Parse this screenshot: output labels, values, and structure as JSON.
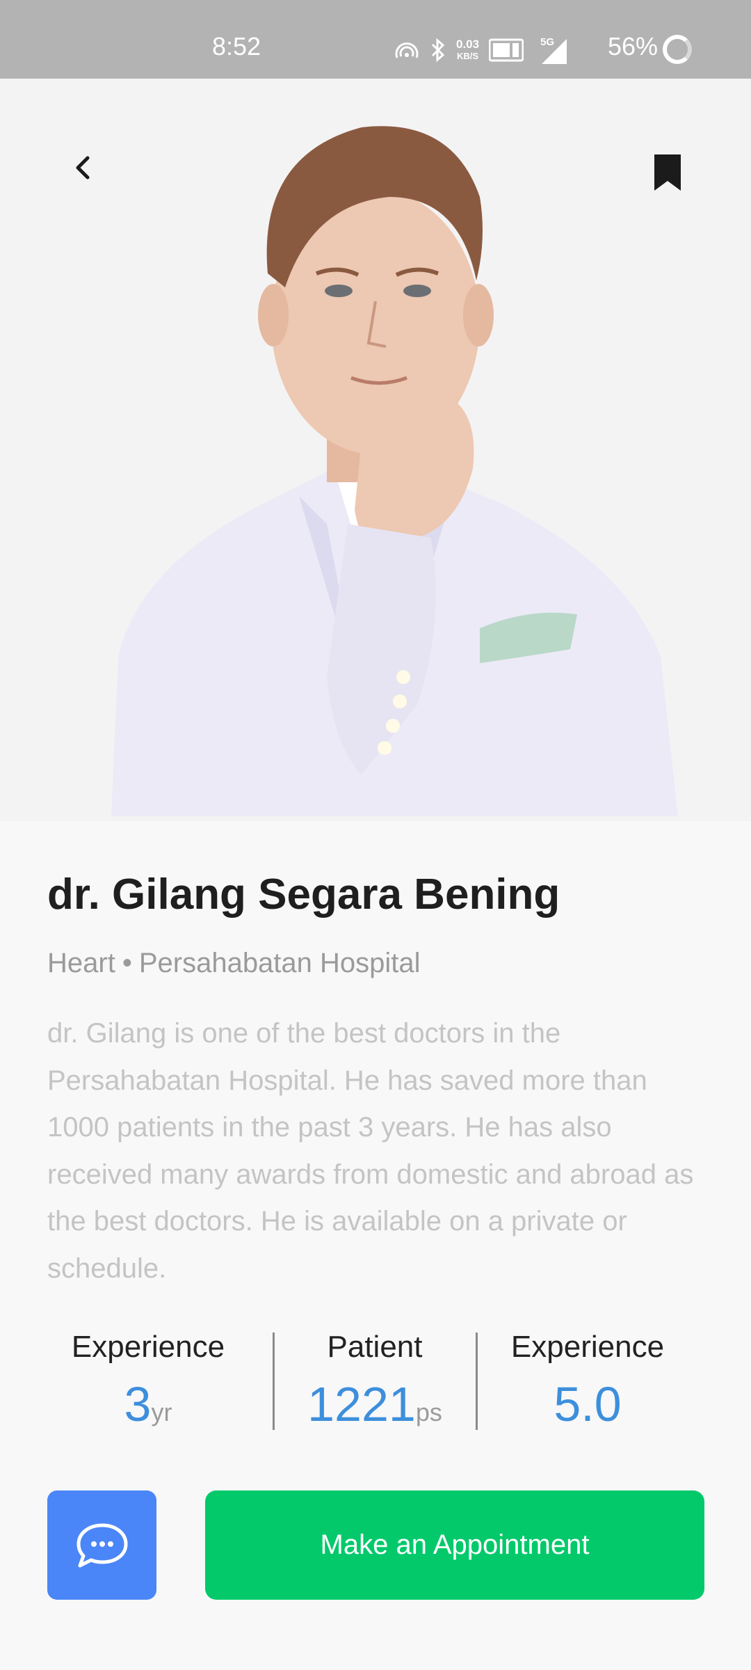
{
  "status_bar": {
    "time": "8:52",
    "net_speed_value": "0.03",
    "net_speed_unit": "KB/S",
    "network_type": "5G",
    "battery": "56%"
  },
  "doctor": {
    "name": "dr. Gilang Segara Bening",
    "specialty": "Heart",
    "separator": "•",
    "hospital": "Persahabatan Hospital",
    "bio": "dr. Gilang is one of the best doctors in the Persahabatan Hospital. He has saved more than 1000 patients in the past 3 years. He has also received many awards from domestic and abroad as the best doctors. He is available on a private or schedule."
  },
  "stats": [
    {
      "label": "Experience",
      "value": "3",
      "unit": "yr"
    },
    {
      "label": "Patient",
      "value": "1221",
      "unit": "ps"
    },
    {
      "label": "Experience",
      "value": "5.0",
      "unit": ""
    }
  ],
  "actions": {
    "appointment_label": "Make an Appointment"
  },
  "colors": {
    "accent_blue": "#3d8fdc",
    "chat_button": "#4a86f7",
    "appointment_button": "#03c96b"
  },
  "icons": {
    "back": "chevron-left-icon",
    "bookmark": "bookmark-icon",
    "chat": "chat-bubble-icon"
  }
}
